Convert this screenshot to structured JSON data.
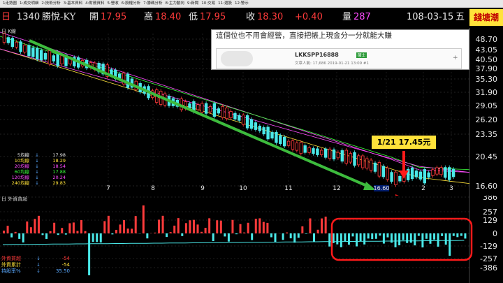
{
  "menu": [
    "1走勢圖",
    "1:成交明細",
    "2:技術分析",
    "3:基本資料",
    "4:財務資料",
    "5:營收",
    "6:股權分析",
    "7:籌碼分析",
    "8:主力動向",
    "9:新聞",
    "10:交易",
    "11:選股",
    "12:警示"
  ],
  "quote": {
    "period_icon": "日",
    "code": "1340",
    "name": "勝悅-KY",
    "open_label": "開",
    "open": "17.95",
    "high_label": "高",
    "high": "18.40",
    "low_label": "低",
    "low": "17.95",
    "close_label": "收",
    "close": "18.30",
    "change": "+0.40",
    "volume_label": "量",
    "volume": "287",
    "date": "108-03-15",
    "weekday": "五",
    "brand": "錢塘潮"
  },
  "panel": {
    "title": "日 K線",
    "sub_title": "日 外資買超"
  },
  "ma_legend": [
    {
      "label": "5均線",
      "value": "17.98",
      "color": "#e8e8e8"
    },
    {
      "label": "10均線",
      "value": "18.29",
      "color": "#ffe23a"
    },
    {
      "label": "20均線",
      "value": "18.54",
      "color": "#ff4cff"
    },
    {
      "label": "60均線",
      "value": "17.88",
      "color": "#3cff3c"
    },
    {
      "label": "120均線",
      "value": "20.24",
      "color": "#ff4cff"
    },
    {
      "label": "240均線",
      "value": "29.83",
      "color": "#ffe23a"
    }
  ],
  "price_axis": [
    "48.70",
    "43.05",
    "40.50",
    "37.90",
    "35.30",
    "31.90",
    "29.05",
    "26.20",
    "23.35",
    "20.45",
    "16.60"
  ],
  "date_axis": [
    "7",
    "8",
    "9",
    "10",
    "11",
    "12",
    "1",
    "2",
    "3"
  ],
  "last_price_label": "16.60",
  "sub_axis": [
    "386",
    "257",
    "129",
    "0",
    "-129",
    "-257",
    "-386"
  ],
  "bottom_legend": [
    {
      "label": "外資買超",
      "value": "-54",
      "color": "#ff3b3b"
    },
    {
      "label": "外資累計",
      "value": "-54",
      "color": "#ffe23a"
    },
    {
      "label": "持股率%",
      "value": "35.50",
      "color": "#5aa9ff"
    }
  ],
  "popup": {
    "text": "這個位也不用會經營，直接把帳上現金分一分就能大賺",
    "user": "LKKSPP16888",
    "badge": "碩士",
    "stats": "文章人氣: 17,686   2019-01-21 13:09  #1",
    "plus": "+"
  },
  "annotation": "1/21 17.45元",
  "colors": {
    "up": "#ff3b3b",
    "down": "#4ae8e8",
    "trend": "#3dbb3d",
    "annot": "#ffe23a"
  }
}
